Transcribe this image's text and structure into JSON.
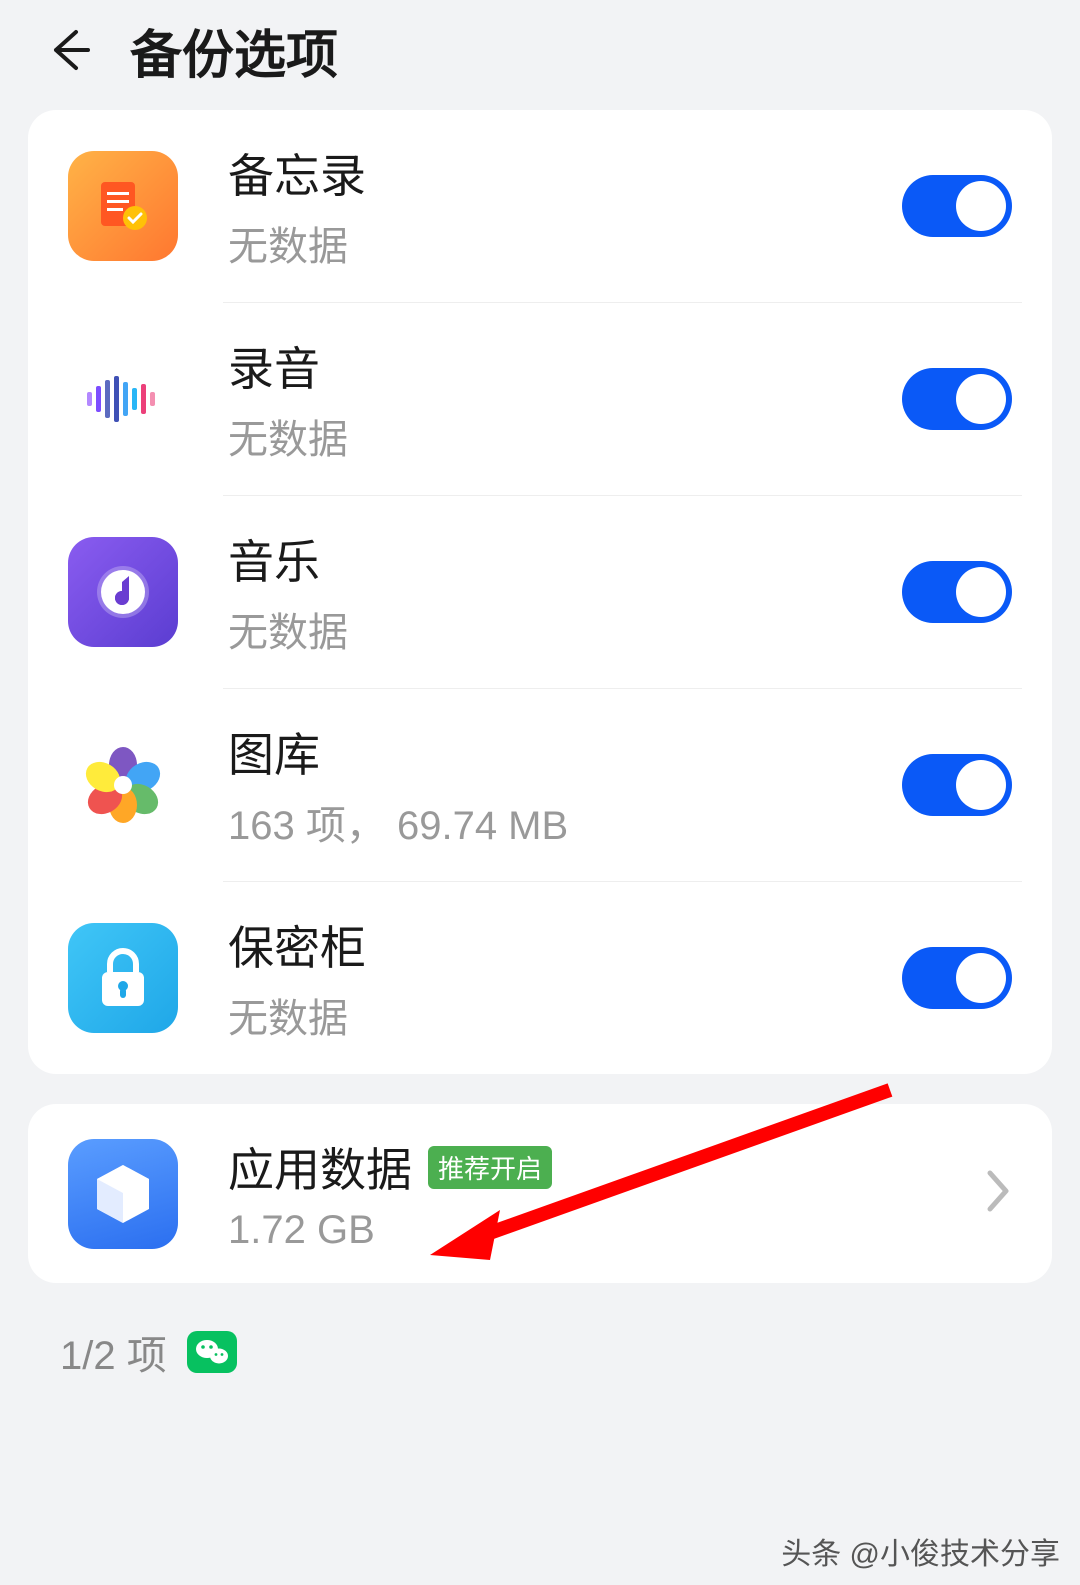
{
  "header": {
    "title": "备份选项"
  },
  "items": [
    {
      "title": "备忘录",
      "subtitle": "无数据",
      "toggle": true
    },
    {
      "title": "录音",
      "subtitle": "无数据",
      "toggle": true
    },
    {
      "title": "音乐",
      "subtitle": "无数据",
      "toggle": true
    },
    {
      "title": "图库",
      "subtitle": "163 项，  69.74 MB",
      "toggle": true
    },
    {
      "title": "保密柜",
      "subtitle": "无数据",
      "toggle": true
    }
  ],
  "app_data": {
    "title": "应用数据",
    "badge": "推荐开启",
    "subtitle": "1.72 GB"
  },
  "footer": {
    "count": "1/2 项"
  },
  "watermark": "头条 @小俊技术分享"
}
